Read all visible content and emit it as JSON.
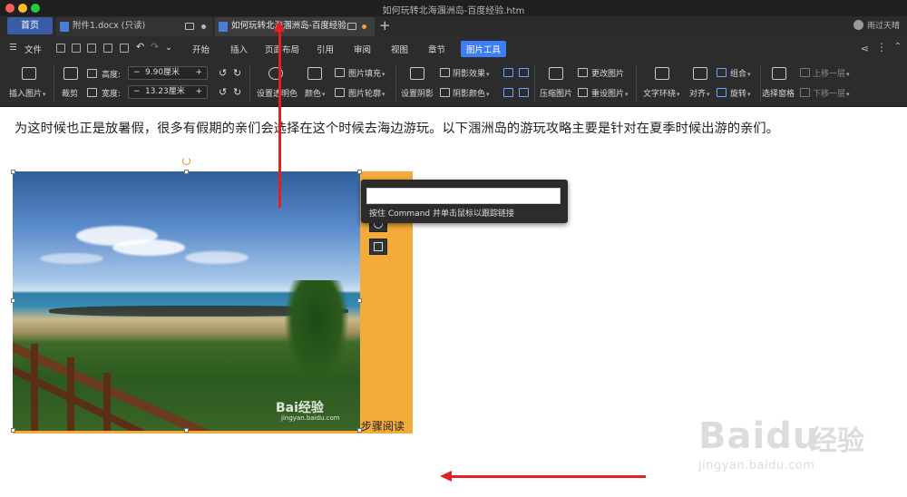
{
  "window": {
    "title": "如何玩转北海涠洲岛-百度经验.htm"
  },
  "tabs": {
    "home": "首页",
    "items": [
      {
        "label": "附件1.docx (只读)"
      },
      {
        "label": "如何玩转北海涠洲岛-百度经验"
      }
    ],
    "new_tab": "+",
    "user": "雨过天晴"
  },
  "menu": {
    "file": "文件",
    "items": [
      "开始",
      "插入",
      "页面布局",
      "引用",
      "审阅",
      "视图",
      "章节",
      "图片工具"
    ],
    "active": "图片工具"
  },
  "ribbon": {
    "insert_image": "插入图片",
    "crop": "裁剪",
    "height_label": "高度:",
    "height_value": "9.90厘米",
    "width_label": "宽度:",
    "width_value": "13.23厘米",
    "transparent": "设置透明色",
    "color": "颜色",
    "fill": "图片填充",
    "outline": "图片轮廓",
    "shadow": "设置阴影",
    "shadow_effect": "阴影效果",
    "shadow_color": "阴影颜色",
    "compress": "压缩图片",
    "change_image": "更改图片",
    "reset_image": "重设图片",
    "wrap_text": "文字环绕",
    "align": "对齐",
    "group": "组合",
    "rotate": "旋转",
    "selection_pane": "选择窗格",
    "bring_forward": "上移一层",
    "send_backward": "下移一层",
    "minus": "−",
    "plus": "+"
  },
  "document": {
    "paragraph": "为这时候也正是放暑假，很多有假期的亲们会选择在这个时候去海边游玩。以下涠洲岛的游玩攻略主要是针对在夏季时候出游的亲们。",
    "reading_label": "步骤阅读",
    "tooltip_hint": "按住 Command 并单击鼠标以跟踪链接",
    "photo_watermark_logo": "Bai经验",
    "photo_watermark_url": "jingyan.baidu.com",
    "page_watermark": "Baidu",
    "page_watermark_cn": "经验",
    "page_watermark_url": "jingyan.baidu.com"
  },
  "colors": {
    "accent": "#3d7ef7",
    "panel_orange": "#f4ab3a",
    "annotation_red": "#e51f1f"
  }
}
